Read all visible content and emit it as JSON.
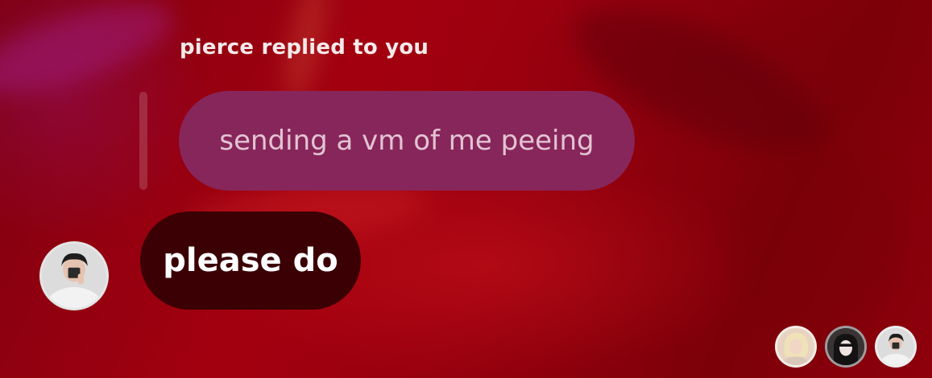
{
  "reply": {
    "label": "pierce replied to you",
    "quoted_text": "sending a vm of me peeing"
  },
  "message": {
    "text": "please do",
    "sender_avatar": "user-avatar-photo"
  },
  "seen_by": [
    {
      "avatar": "viewer-avatar-1"
    },
    {
      "avatar": "viewer-avatar-2"
    },
    {
      "avatar": "viewer-avatar-3"
    }
  ],
  "colors": {
    "background": "#9a000e",
    "quoted_bubble": "#87265a",
    "quoted_text": "#e3c3d2",
    "message_bubble": "#3b0004",
    "message_text": "#ffffff"
  }
}
